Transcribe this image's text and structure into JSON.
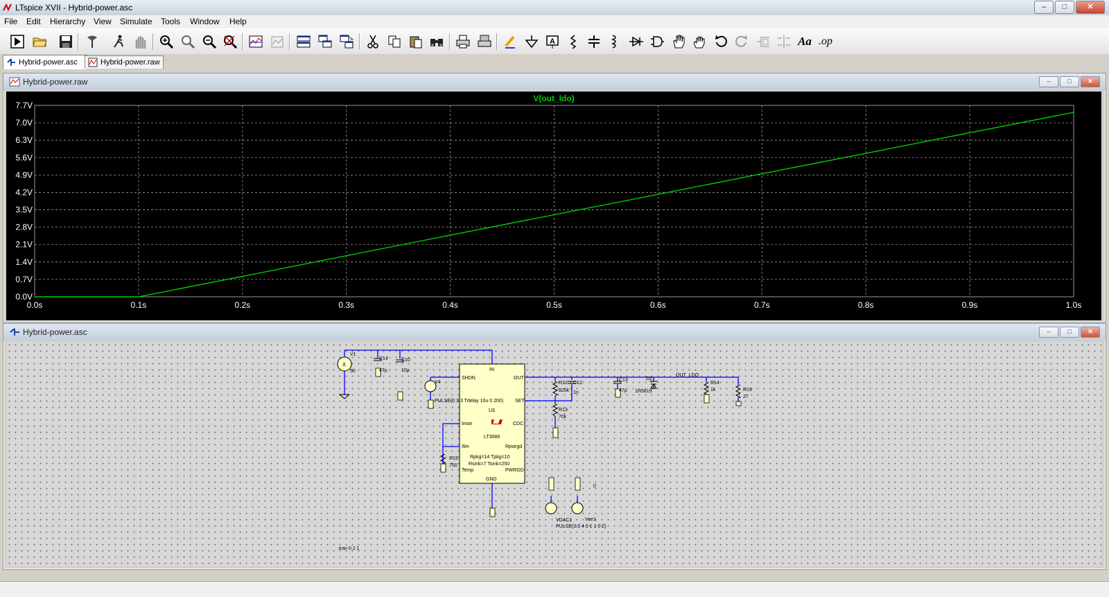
{
  "window": {
    "title": "LTspice XVII - Hybrid-power.asc",
    "buttons": {
      "minimize": "–",
      "maximize": "□",
      "close": "✕"
    }
  },
  "menu": [
    "File",
    "Edit",
    "Hierarchy",
    "View",
    "Simulate",
    "Tools",
    "Window",
    "Help"
  ],
  "toolbar": {
    "groups": [
      [
        "run-icon",
        "open-icon",
        "save-icon"
      ],
      [
        "control-panel-icon",
        "run-sim-icon",
        "halt-icon"
      ],
      [
        "zoom-in-icon",
        "zoom-pan-icon",
        "zoom-out-icon",
        "zoom-fit-icon"
      ],
      [
        "plot-settings-icon",
        "plot-settings2-icon"
      ],
      [
        "tile-horizontal-icon",
        "cascade-icon",
        "tile-windows-icon"
      ],
      [
        "cut-icon",
        "copy-icon",
        "paste-icon",
        "find-icon"
      ],
      [
        "print-icon",
        "print-setup-icon"
      ],
      [
        "wire-icon",
        "ground-icon",
        "label-net-icon",
        "resistor-icon",
        "capacitor-icon",
        "inductor-icon",
        "diode-icon",
        "component-icon",
        "move-icon",
        "drag-icon",
        "undo-icon",
        "redo-icon",
        "rotate-icon",
        "mirror-icon",
        "text-icon",
        "spice-directive-icon"
      ]
    ],
    "text_labels": {
      "text": "Aa",
      "directive": ".op"
    }
  },
  "doc_tabs": [
    {
      "label": "Hybrid-power.asc",
      "active": true
    },
    {
      "label": "Hybrid-power.raw",
      "active": false
    }
  ],
  "plot_window": {
    "title": "Hybrid-power.raw",
    "background": "#000000",
    "trace_color": "#00cc00",
    "grid_color": "#9a9a9a",
    "axis_label_color": "#ffffff"
  },
  "chart_data": {
    "type": "line",
    "title": "V(out_ldo)",
    "xlabel": "",
    "ylabel": "",
    "xlim": [
      0.0,
      1.0
    ],
    "ylim": [
      0.0,
      7.7
    ],
    "x_ticks": [
      "0.0s",
      "0.1s",
      "0.2s",
      "0.3s",
      "0.4s",
      "0.5s",
      "0.6s",
      "0.7s",
      "0.8s",
      "0.9s",
      "1.0s"
    ],
    "x_tick_values": [
      0.0,
      0.1,
      0.2,
      0.3,
      0.4,
      0.5,
      0.6,
      0.7,
      0.8,
      0.9,
      1.0
    ],
    "y_ticks": [
      "7.7V",
      "7.0V",
      "6.3V",
      "5.6V",
      "4.9V",
      "4.2V",
      "3.5V",
      "2.8V",
      "2.1V",
      "1.4V",
      "0.7V",
      "0.0V"
    ],
    "y_tick_values": [
      7.7,
      7.0,
      6.3,
      5.6,
      4.9,
      4.2,
      3.5,
      2.8,
      2.1,
      1.4,
      0.7,
      0.0
    ],
    "grid": true,
    "series": [
      {
        "name": "V(out_ldo)",
        "x": [
          0.0,
          0.1,
          0.2,
          0.3,
          0.4,
          0.5,
          0.6,
          0.7,
          0.8,
          0.9,
          1.0
        ],
        "y": [
          0.0,
          0.0,
          0.82,
          1.65,
          2.48,
          3.3,
          4.12,
          4.95,
          5.77,
          6.6,
          7.42
        ]
      }
    ]
  },
  "schematic_window": {
    "title": "Hybrid-power.asc",
    "wire_color": "#0000ff",
    "component_fill": "#ffffc8",
    "ic": {
      "pins_left": [
        "SHDN",
        "Imon",
        "Ilim",
        "Temp"
      ],
      "pins_right": [
        "OUT",
        "SET",
        "CDC",
        "Rpwrgd",
        "PWRGD"
      ],
      "pin_top": "IN",
      "pin_bottom": "GND",
      "ref": "U3",
      "part": "LT3086",
      "params1": "Rpkg=14 Tpkg=10",
      "params2": "Rsink=7 Tsink=250"
    },
    "labels": {
      "V1": "V1",
      "V1_val": "50",
      "C14": "C14",
      "C14_val": "47µ",
      "C10": "C10",
      "C10_val": "10µ",
      "V4": "V4",
      "V4_val": "PULSE(0 3.3 Tdelay 10u 0 200)",
      "R12": "R12",
      "R12_val": "820k",
      "C12": "C12",
      "C12_val": "1n",
      "R13": "R13",
      "R13_val": "70k",
      "C13": "C13",
      "C13_val": "47µ",
      "D2": "D2",
      "D2_val": "1N5819",
      "net_out": "OUT_LDO",
      "R14": "R14",
      "R14_val": "1k",
      "R16": "R16",
      "R16_val": "27",
      "R15": "R15",
      "R15_val": "750",
      "VDAC1": "VDAC1",
      "VDAC1_val": "PULSE(3.3 4 0 1 1 0 2)",
      "Vee1": "Vee1",
      "vee_node": "0",
      "directive": ".tran 0 2 1"
    }
  }
}
